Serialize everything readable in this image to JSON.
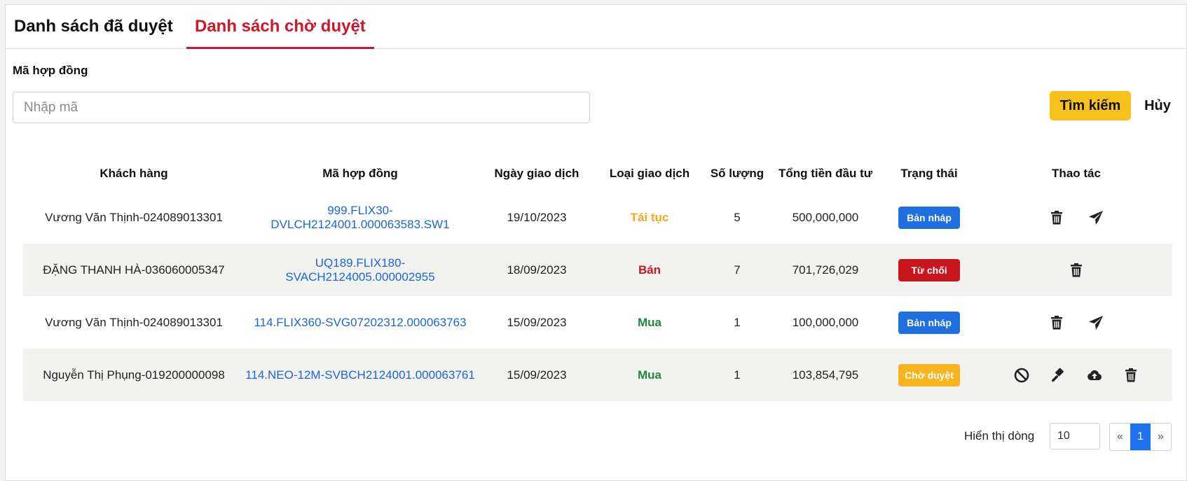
{
  "tabs": {
    "approved": "Danh sách đã duyệt",
    "pending": "Danh sách chờ duyệt"
  },
  "filter": {
    "label": "Mã hợp đồng",
    "placeholder": "Nhập mã",
    "search_button": "Tìm kiếm",
    "cancel_button": "Hủy"
  },
  "table": {
    "headers": {
      "customer": "Khách hàng",
      "contract": "Mã hợp đồng",
      "date": "Ngày giao dịch",
      "type": "Loại giao dịch",
      "quantity": "Số lượng",
      "total": "Tổng tiền đầu tư",
      "status": "Trạng thái",
      "actions": "Thao tác"
    },
    "rows": [
      {
        "customer": "Vương Văn Thịnh-024089013301",
        "contract": "999.FLIX30-DVLCH2124001.000063583.SW1",
        "date": "19/10/2023",
        "type": "Tái tục",
        "quantity": "5",
        "total": "500,000,000",
        "status": "Bản nháp"
      },
      {
        "customer": "ĐẶNG THANH HÀ-036060005347",
        "contract": "UQ189.FLIX180-SVACH2124005.000002955",
        "date": "18/09/2023",
        "type": "Bán",
        "quantity": "7",
        "total": "701,726,029",
        "status": "Từ chối"
      },
      {
        "customer": "Vương Văn Thịnh-024089013301",
        "contract": "114.FLIX360-SVG07202312.000063763",
        "date": "15/09/2023",
        "type": "Mua",
        "quantity": "1",
        "total": "100,000,000",
        "status": "Bản nháp"
      },
      {
        "customer": "Nguyễn Thị Phụng-019200000098",
        "contract": "114.NEO-12M-SVBCH2124001.000063761",
        "date": "15/09/2023",
        "type": "Mua",
        "quantity": "1",
        "total": "103,854,795",
        "status": "Chờ duyệt"
      }
    ]
  },
  "icons": {
    "delete": "trash-icon",
    "send": "paper-plane-icon",
    "reject": "ban-icon",
    "approve": "gavel-icon",
    "upload": "cloud-upload-icon"
  },
  "colors": {
    "accent_red": "#d0162b",
    "search_button": "#f9c11b",
    "link": "#1a66d6",
    "draft": "#1f6fe0",
    "rejected": "#c8161d",
    "pending": "#f9b41f",
    "renew": "#f2a91d",
    "buy": "#1e8a3a"
  },
  "pagination": {
    "label": "Hiển thị dòng",
    "rows_per_page": "10",
    "prev": "«",
    "current": "1",
    "next": "»"
  }
}
